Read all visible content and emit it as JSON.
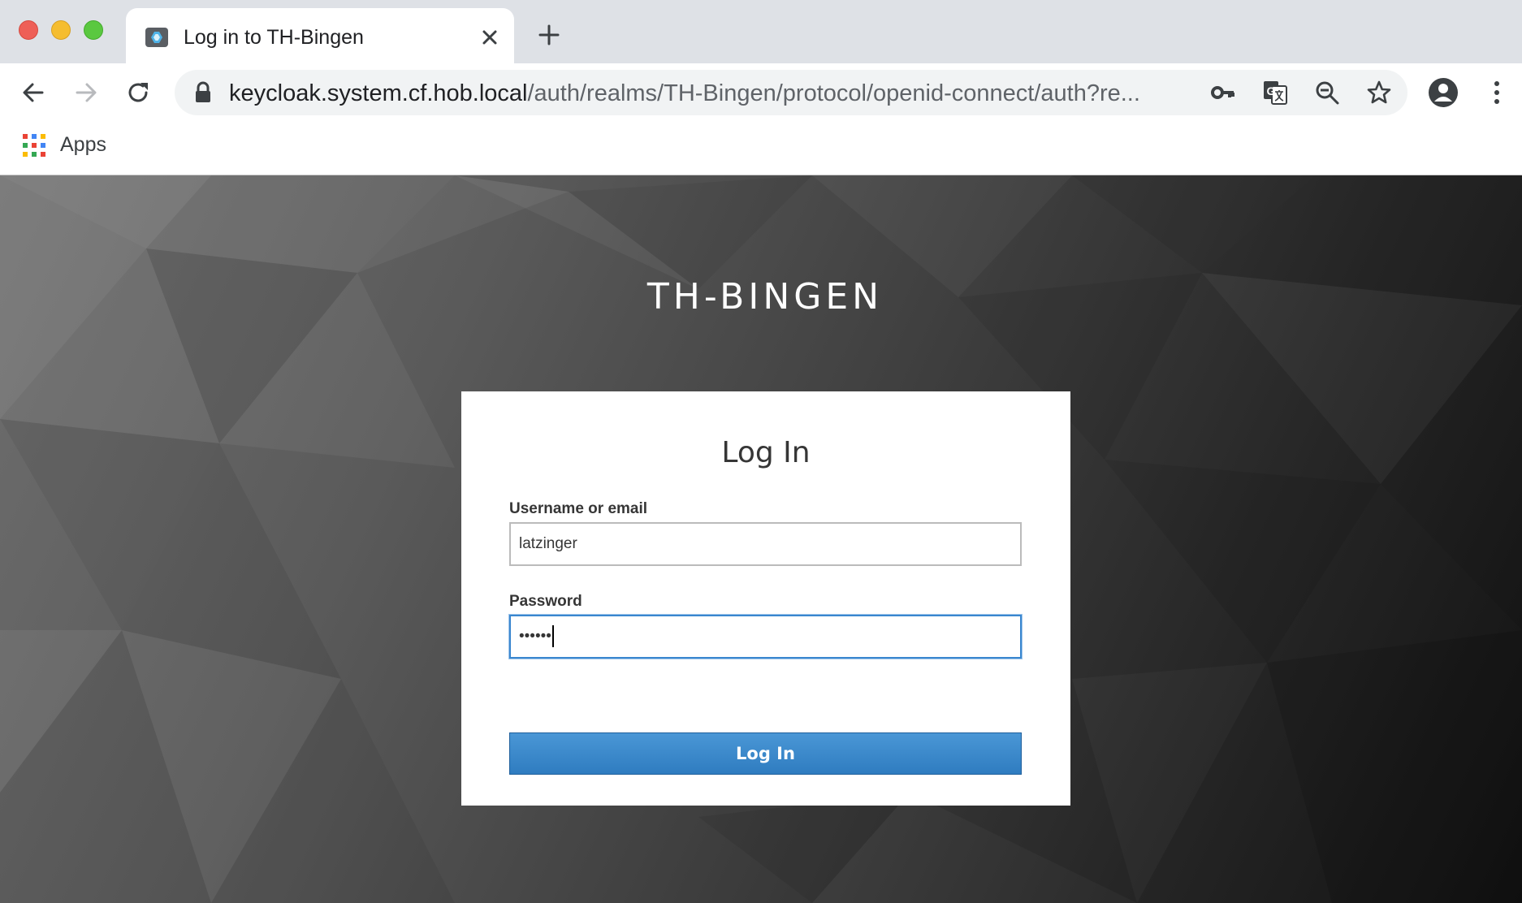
{
  "browser": {
    "tab": {
      "title": "Log in to TH-Bingen"
    },
    "address": {
      "host": "keycloak.system.cf.hob.local",
      "path": "/auth/realms/TH-Bingen/protocol/openid-connect/auth?re..."
    },
    "bookmarks": {
      "apps_label": "Apps"
    }
  },
  "page": {
    "realm_title": "TH-BINGEN",
    "form": {
      "title": "Log In",
      "username_label": "Username or email",
      "username_value": "latzinger",
      "password_label": "Password",
      "password_value": "••••••",
      "submit_label": "Log In"
    }
  },
  "colors": {
    "primary_button": "#3a87cf",
    "focus_border": "#3a87cf",
    "background_dark": "#1a1a1a"
  },
  "icons": [
    "back-icon",
    "forward-icon",
    "reload-icon",
    "lock-icon",
    "key-icon",
    "translate-icon",
    "zoom-out-icon",
    "star-icon",
    "profile-icon",
    "menu-icon",
    "apps-grid-icon"
  ]
}
